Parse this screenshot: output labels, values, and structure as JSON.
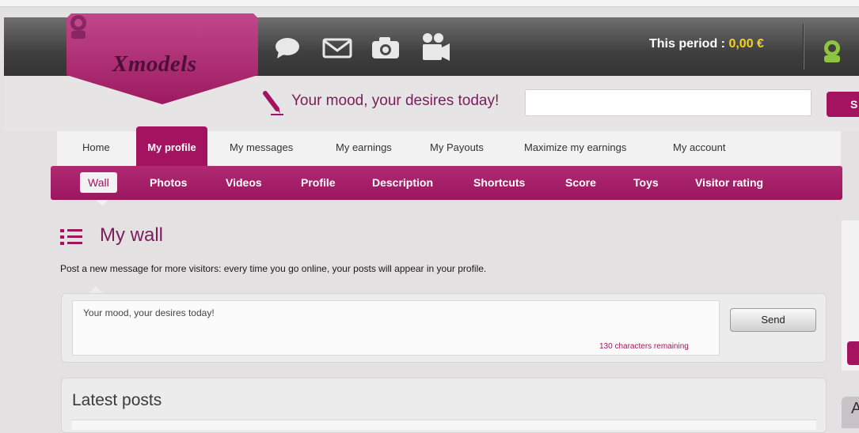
{
  "brand": {
    "name": "Xmodels",
    "accent": "#a3135f",
    "dark_accent": "#7a1d5c"
  },
  "header": {
    "icons": [
      "chat-bubble-icon",
      "envelope-icon",
      "camera-icon",
      "video-camera-icon"
    ],
    "period_label": "This period : ",
    "period_value": "0,00 €",
    "search_button_label": "S"
  },
  "mood": {
    "label": "Your mood, your desires today!",
    "input_value": ""
  },
  "tabs": [
    {
      "label": "Home",
      "active": false
    },
    {
      "label": "My profile",
      "active": true
    },
    {
      "label": "My messages",
      "active": false
    },
    {
      "label": "My earnings",
      "active": false
    },
    {
      "label": "My Payouts",
      "active": false
    },
    {
      "label": "Maximize my earnings",
      "active": false
    },
    {
      "label": "My account",
      "active": false
    }
  ],
  "subtabs": [
    {
      "label": "Wall",
      "active": true
    },
    {
      "label": "Photos"
    },
    {
      "label": "Videos"
    },
    {
      "label": "Profile"
    },
    {
      "label": "Description"
    },
    {
      "label": "Shortcuts"
    },
    {
      "label": "Score"
    },
    {
      "label": "Toys"
    },
    {
      "label": "Visitor rating"
    }
  ],
  "wall": {
    "title": "My wall",
    "description": "Post a new message for more visitors: every time you go online, your posts will appear in your profile.",
    "post_placeholder": "Your mood, your desires today!",
    "remaining": "130 characters remaining",
    "send_label": "Send"
  },
  "latest": {
    "title": "Latest posts"
  },
  "side": {
    "letter": "A"
  }
}
